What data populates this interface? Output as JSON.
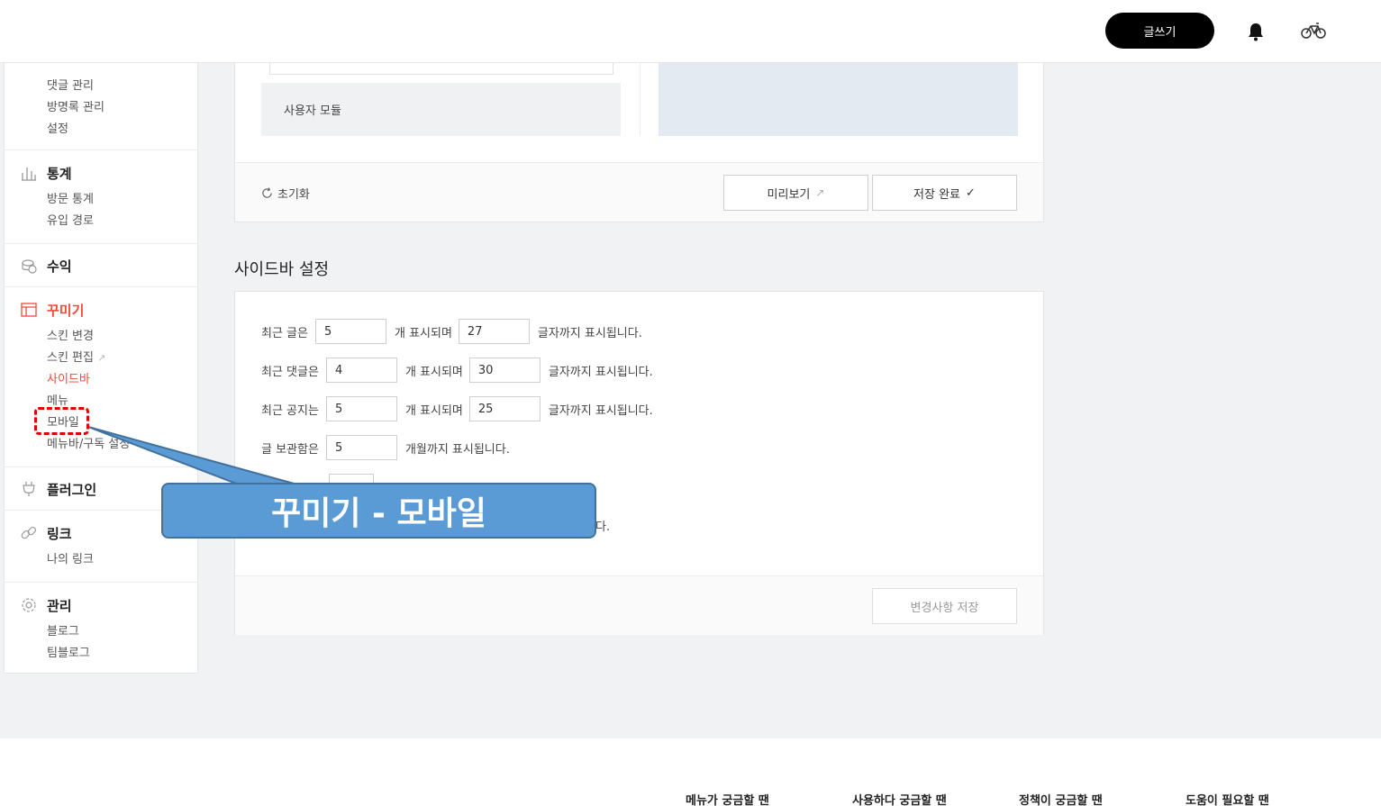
{
  "header": {
    "write_label": "글쓰기",
    "bell_icon": "bell-icon",
    "avatar_icon": "bicycle-icon"
  },
  "sidebar": {
    "top_partial": {
      "items": [
        "댓글 관리",
        "방명록 관리",
        "설정"
      ]
    },
    "stats": {
      "label": "통계",
      "items": [
        "방문 통계",
        "유입 경로"
      ]
    },
    "revenue": {
      "label": "수익"
    },
    "decorate": {
      "label": "꾸미기",
      "items": [
        "스킨 변경",
        "스킨 편집",
        "사이드바",
        "메뉴",
        "모바일",
        "메뉴바/구독 설정"
      ]
    },
    "plugin": {
      "label": "플러그인"
    },
    "link": {
      "label": "링크",
      "items": [
        "나의 링크"
      ]
    },
    "manage": {
      "label": "관리",
      "items": [
        "블로그",
        "팀블로그"
      ]
    }
  },
  "customizer": {
    "user_module": "사용자 모듈",
    "reset_label": "초기화",
    "preview_label": "미리보기",
    "save_done_label": "저장 완료"
  },
  "sidebar_settings": {
    "title": "사이드바 설정",
    "rows": [
      {
        "prefix": "최근 글은",
        "count": "5",
        "middle": "개 표시되며",
        "chars": "27",
        "suffix": "글자까지 표시됩니다."
      },
      {
        "prefix": "최근 댓글은",
        "count": "4",
        "middle": "개 표시되며",
        "chars": "30",
        "suffix": "글자까지 표시됩니다."
      },
      {
        "prefix": "최근 공지는",
        "count": "5",
        "middle": "개 표시되며",
        "chars": "25",
        "suffix": "글자까지 표시됩니다."
      },
      {
        "prefix": "글 보관함은",
        "count": "5",
        "suffix": "개월까지 표시됩니다."
      }
    ],
    "partial_row_tail": "다.",
    "save_label": "변경사항 저장"
  },
  "footer": {
    "links": [
      "메뉴가 궁금할 땐",
      "사용하다 궁금할 땐",
      "정책이 궁금할 땐",
      "도움이 필요할 땐"
    ]
  },
  "annotation": {
    "callout": "꾸미기 - 모바일",
    "color": "#5b9bd5",
    "highlight_color": "#e00000"
  }
}
